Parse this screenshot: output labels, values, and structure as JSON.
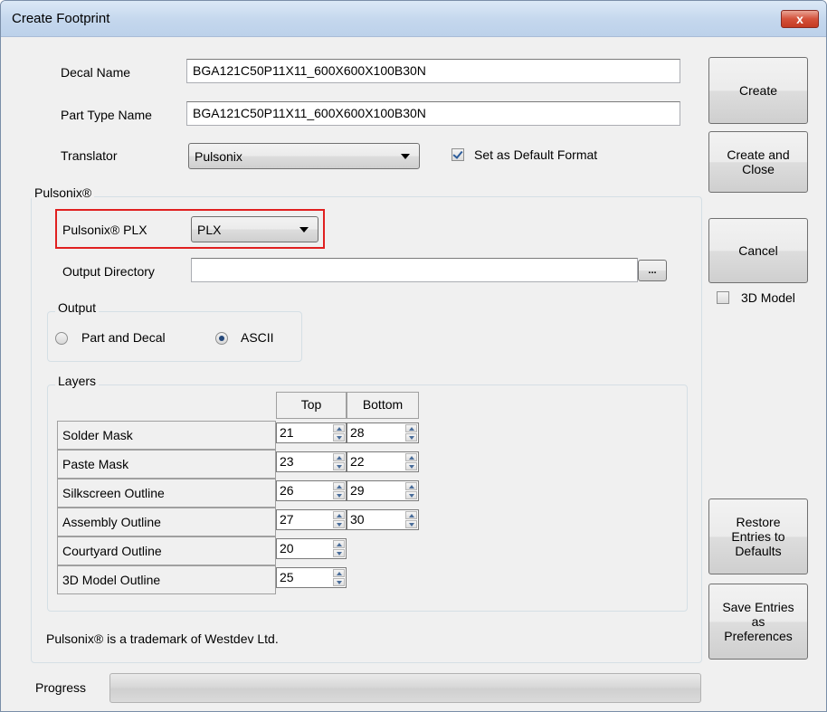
{
  "window": {
    "title": "Create Footprint",
    "close_glyph": "x"
  },
  "form": {
    "decal_name_label": "Decal Name",
    "decal_name_value": "BGA121C50P11X11_600X600X100B30N",
    "part_type_name_label": "Part Type Name",
    "part_type_name_value": "BGA121C50P11X11_600X600X100B30N",
    "translator_label": "Translator",
    "translator_value": "Pulsonix",
    "default_format_label": "Set as Default Format",
    "default_format_checked": true
  },
  "pulsonix_group": {
    "caption": "Pulsonix®",
    "plx_label": "Pulsonix® PLX",
    "plx_value": "PLX",
    "output_dir_label": "Output Directory",
    "output_dir_value": "",
    "browse_label": "...",
    "output_group": {
      "caption": "Output",
      "option_part_and_decal": "Part and Decal",
      "option_ascii": "ASCII",
      "selected": "ASCII"
    },
    "layers_group": {
      "caption": "Layers",
      "col_top": "Top",
      "col_bottom": "Bottom",
      "rows": [
        {
          "name": "Solder Mask",
          "top": "21",
          "bottom": "28"
        },
        {
          "name": "Paste Mask",
          "top": "23",
          "bottom": "22"
        },
        {
          "name": "Silkscreen Outline",
          "top": "26",
          "bottom": "29"
        },
        {
          "name": "Assembly Outline",
          "top": "27",
          "bottom": "30"
        },
        {
          "name": "Courtyard Outline",
          "top": "20",
          "bottom": ""
        },
        {
          "name": "3D Model Outline",
          "top": "25",
          "bottom": ""
        }
      ]
    },
    "trademark_note": "Pulsonix® is a trademark of Westdev Ltd."
  },
  "buttons": {
    "create": "Create",
    "create_and_close": "Create and\nClose",
    "cancel": "Cancel",
    "model_3d_label": "3D Model",
    "model_3d_checked": false,
    "restore_defaults": "Restore\nEntries to\nDefaults",
    "save_preferences": "Save Entries\nas\nPreferences"
  },
  "progress": {
    "label": "Progress",
    "value": 0
  },
  "colors": {
    "highlight": "#e02020",
    "titlebar": "#c4d7ed",
    "close_button": "#c43a22"
  }
}
